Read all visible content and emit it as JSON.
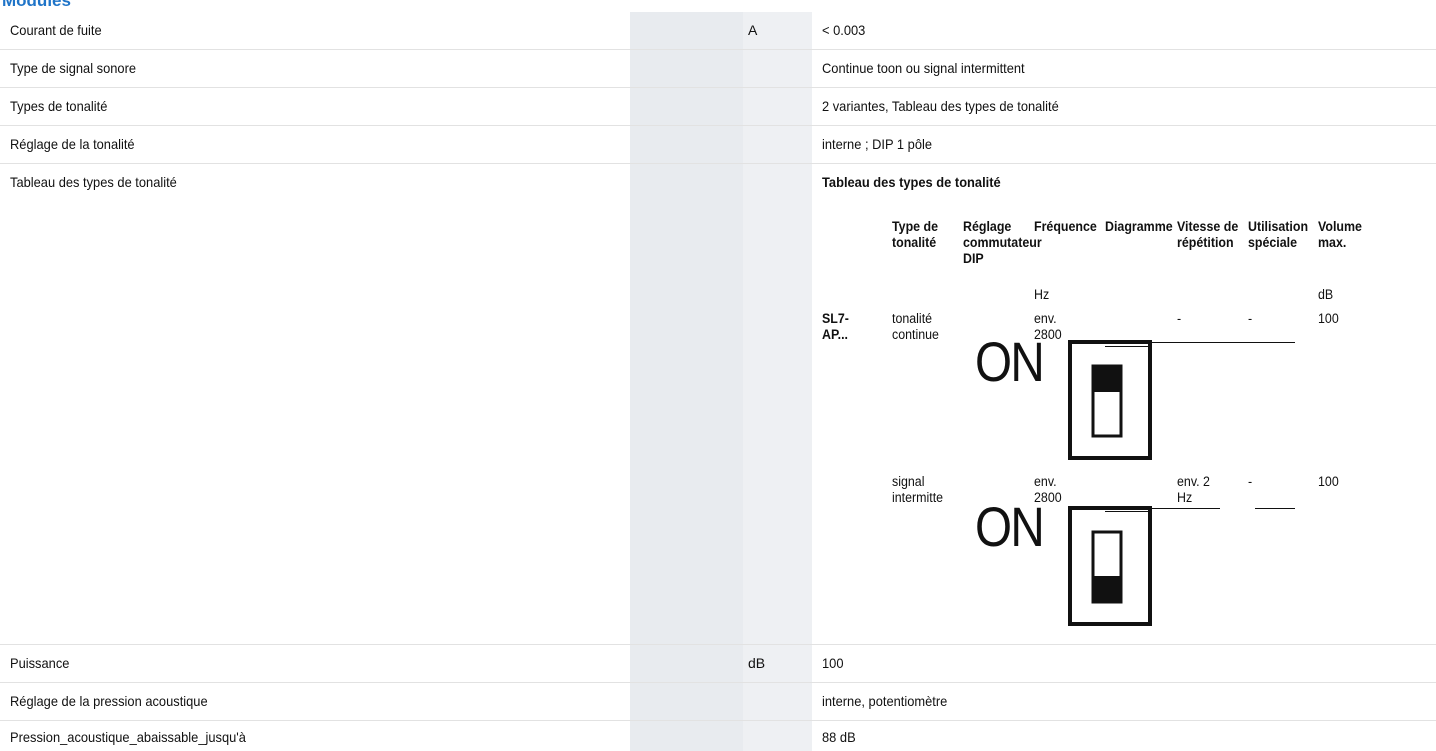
{
  "heading": "Modules",
  "rows": [
    {
      "label": "Courant de fuite",
      "unit": "A",
      "value": "< 0.003"
    },
    {
      "label": "Type de signal sonore",
      "unit": "",
      "value": "Continue toon ou signal intermittent"
    },
    {
      "label": "Types de tonalité",
      "unit": "",
      "value": "2 variantes, Tableau des types de tonalité"
    },
    {
      "label": "Réglage de la tonalité",
      "unit": "",
      "value": "interne ; DIP 1 pôle"
    },
    {
      "label": "Tableau des types de tonalité",
      "unit": "",
      "value": "Tableau des types de tonalité"
    },
    {
      "label": "Puissance",
      "unit": "dB",
      "value": "100"
    },
    {
      "label": "Réglage de la pression acoustique",
      "unit": "",
      "value": "interne, potentiomètre"
    },
    {
      "label": "Pression_acoustique_abaissable_jusqu'à",
      "unit": "",
      "value": "88 dB"
    }
  ],
  "tone_table": {
    "headers": {
      "type": "Type de tonalité",
      "dip": "Réglage commutateur DIP",
      "freq": "Fréquence",
      "diagram": "Diagramme",
      "speed": "Vitesse de répétition",
      "usage": "Utilisation spéciale",
      "volume": "Volume max."
    },
    "units": {
      "freq": "Hz",
      "volume": "dB"
    },
    "model": "SL7-AP...",
    "switch_label": "ON",
    "rows": [
      {
        "type": "tonalité continue",
        "freq": "env. 2800",
        "speed": "-",
        "usage": "-",
        "volume": "100",
        "switch_position": "up"
      },
      {
        "type": "signal intermitte",
        "freq": "env. 2800",
        "speed": "env. 2 Hz",
        "usage": "-",
        "volume": "100",
        "switch_position": "down"
      }
    ]
  }
}
